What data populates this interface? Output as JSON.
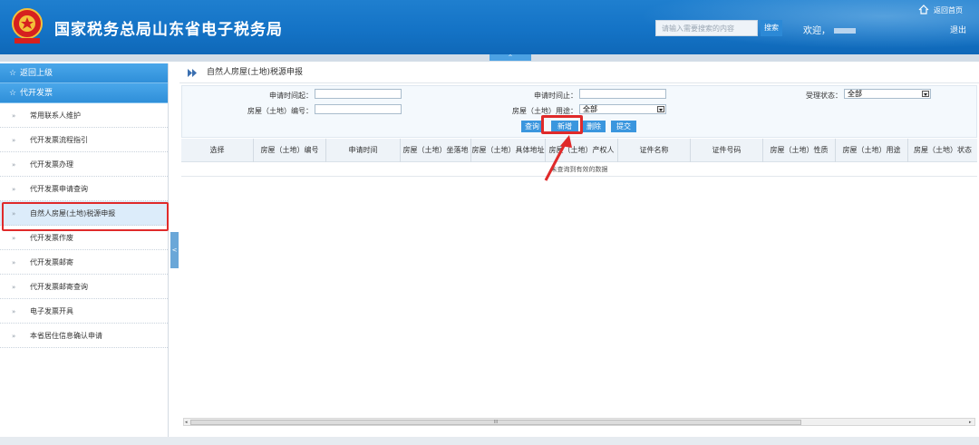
{
  "header": {
    "title": "国家税务总局山东省电子税务局",
    "search_placeholder": "请输入需要搜索的内容",
    "search_button": "搜索",
    "welcome": "欢迎，",
    "home_link": "返回首页",
    "logout": "退出",
    "collapse_glyph": "^"
  },
  "sidebar": {
    "back_label": "返回上级",
    "section_label": "代开发票",
    "items": [
      {
        "label": "常用联系人维护"
      },
      {
        "label": "代开发票流程指引"
      },
      {
        "label": "代开发票办理"
      },
      {
        "label": "代开发票申请查询"
      },
      {
        "label": "自然人房屋(土地)税源申报"
      },
      {
        "label": "代开发票作废"
      },
      {
        "label": "代开发票邮寄"
      },
      {
        "label": "代开发票邮寄查询"
      },
      {
        "label": "电子发票开具"
      },
      {
        "label": "本省居住信息确认申请"
      }
    ],
    "active_index": 4,
    "toggle_glyph": "<"
  },
  "main": {
    "breadcrumb": "自然人房屋(土地)税源申报",
    "form": {
      "apply_start_label": "申请时间起：",
      "apply_end_label": "申请时间止：",
      "status_label": "受理状态：",
      "status_value": "全部",
      "house_no_label": "房屋（土地）编号：",
      "usage_label": "房屋（土地）用途：",
      "usage_value": "全部"
    },
    "buttons": {
      "query": "查询",
      "add": "新增",
      "delete": "删除",
      "submit": "提交"
    },
    "columns": [
      "选择",
      "房屋（土地）编号",
      "申请时间",
      "房屋（土地）坐落地",
      "房屋（土地）具体地址",
      "房屋（土地）产权人",
      "证件名称",
      "证件号码",
      "房屋（土地）性质",
      "房屋（土地）用途",
      "房屋（土地）状态"
    ],
    "empty_message": "未查询到有效的数据",
    "scroll_thumb_label": "III"
  },
  "colors": {
    "header_blue": "#1473c6",
    "accent_blue": "#3a96de",
    "highlight_red": "#e02a2a",
    "emblem_red": "#d6201f",
    "emblem_gold": "#f3c13a"
  }
}
